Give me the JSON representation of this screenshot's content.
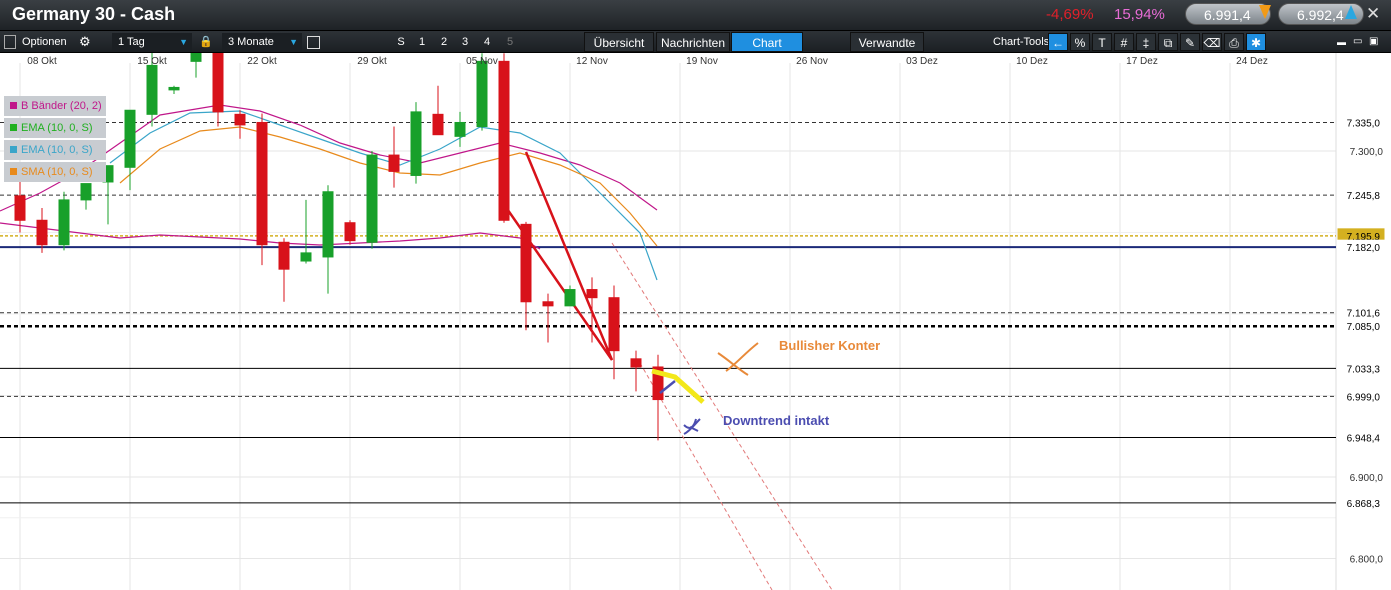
{
  "window": {
    "title": "Germany 30 - Cash",
    "change_pct": "-4,69%",
    "change_pct2": "15,94%",
    "bid": "6.991,4",
    "ask": "6.992,4",
    "close": "✕"
  },
  "toolbar": {
    "options_label": "Optionen",
    "interval_label": "1 Tag",
    "range_label": "3 Monate",
    "periods": [
      "S",
      "1",
      "2",
      "3",
      "4",
      "5"
    ],
    "tabs": [
      "Übersicht",
      "Nachrichten",
      "Chart",
      "Verwandte"
    ],
    "active_tab": "Chart",
    "chart_tools_label": "Chart-Tools",
    "window_controls": [
      "▬",
      "▭",
      "▣"
    ]
  },
  "legend": [
    {
      "label": "B Bänder (20, 2)",
      "color": "#c0178a"
    },
    {
      "label": "EMA (10, 0, S)",
      "color": "#20b020"
    },
    {
      "label": "EMA (10, 0, S)",
      "color": "#3aa5c9"
    },
    {
      "label": "SMA (10, 0, S)",
      "color": "#e88a1c"
    }
  ],
  "annotations": {
    "bullish": "Bullisher Konter",
    "downtrend": "Downtrend intakt"
  },
  "colors": {
    "up": "#18a02a",
    "down": "#d8121a",
    "accent": "#1f8fe0"
  },
  "chart_data": {
    "type": "candlestick",
    "x_ticks": [
      "08 Okt",
      "15 Okt",
      "22 Okt",
      "29 Okt",
      "05 Nov",
      "12 Nov",
      "19 Nov",
      "26 Nov",
      "03 Dez",
      "10 Dez",
      "17 Dez",
      "24 Dez"
    ],
    "y_ticks": [
      "7.300,0",
      "6.900,0",
      "6.800,0"
    ],
    "price_labels": [
      "7.335,0",
      "7.245,8",
      "7.195,9",
      "7.182,0",
      "7.101,6",
      "7.085,0",
      "7.033,3",
      "6.999,0",
      "6.948,4",
      "6.868,3"
    ],
    "y_tick_values": [
      7300,
      6900,
      6800
    ],
    "level_values": [
      7335.0,
      7245.8,
      7195.9,
      7182.0,
      7101.6,
      7085.0,
      7033.3,
      6999.0,
      6948.4,
      6868.3
    ],
    "candles": [
      {
        "o": 7245,
        "h": 7265,
        "l": 7200,
        "c": 7215
      },
      {
        "o": 7215,
        "h": 7230,
        "l": 7175,
        "c": 7185
      },
      {
        "o": 7185,
        "h": 7250,
        "l": 7178,
        "c": 7240
      },
      {
        "o": 7240,
        "h": 7255,
        "l": 7228,
        "c": 7260
      },
      {
        "o": 7262,
        "h": 7280,
        "l": 7210,
        "c": 7282
      },
      {
        "o": 7280,
        "h": 7330,
        "l": 7252,
        "c": 7350
      },
      {
        "o": 7345,
        "h": 7440,
        "l": 7330,
        "c": 7405
      },
      {
        "o": 7375,
        "h": 7380,
        "l": 7370,
        "c": 7378
      },
      {
        "o": 7410,
        "h": 7430,
        "l": 7390,
        "c": 7420
      },
      {
        "o": 7420,
        "h": 7440,
        "l": 7330,
        "c": 7348
      },
      {
        "o": 7345,
        "h": 7350,
        "l": 7315,
        "c": 7332
      },
      {
        "o": 7335,
        "h": 7346,
        "l": 7160,
        "c": 7185
      },
      {
        "o": 7188,
        "h": 7193,
        "l": 7115,
        "c": 7155
      },
      {
        "o": 7165,
        "h": 7240,
        "l": 7162,
        "c": 7175
      },
      {
        "o": 7170,
        "h": 7258,
        "l": 7125,
        "c": 7250
      },
      {
        "o": 7212,
        "h": 7215,
        "l": 7185,
        "c": 7190
      },
      {
        "o": 7188,
        "h": 7300,
        "l": 7180,
        "c": 7295
      },
      {
        "o": 7295,
        "h": 7330,
        "l": 7255,
        "c": 7275
      },
      {
        "o": 7270,
        "h": 7360,
        "l": 7260,
        "c": 7348
      },
      {
        "o": 7345,
        "h": 7380,
        "l": 7320,
        "c": 7320
      },
      {
        "o": 7318,
        "h": 7348,
        "l": 7305,
        "c": 7335
      },
      {
        "o": 7330,
        "h": 7420,
        "l": 7325,
        "c": 7410
      },
      {
        "o": 7410,
        "h": 7420,
        "l": 7212,
        "c": 7215
      },
      {
        "o": 7210,
        "h": 7213,
        "l": 7080,
        "c": 7115
      },
      {
        "o": 7115,
        "h": 7125,
        "l": 7065,
        "c": 7110
      },
      {
        "o": 7110,
        "h": 7135,
        "l": 7118,
        "c": 7130
      },
      {
        "o": 7130,
        "h": 7145,
        "l": 7065,
        "c": 7120
      },
      {
        "o": 7120,
        "h": 7135,
        "l": 7020,
        "c": 7055
      },
      {
        "o": 7045,
        "h": 7055,
        "l": 7005,
        "c": 7035
      },
      {
        "o": 7035,
        "h": 7050,
        "l": 6945,
        "c": 6995
      }
    ]
  }
}
